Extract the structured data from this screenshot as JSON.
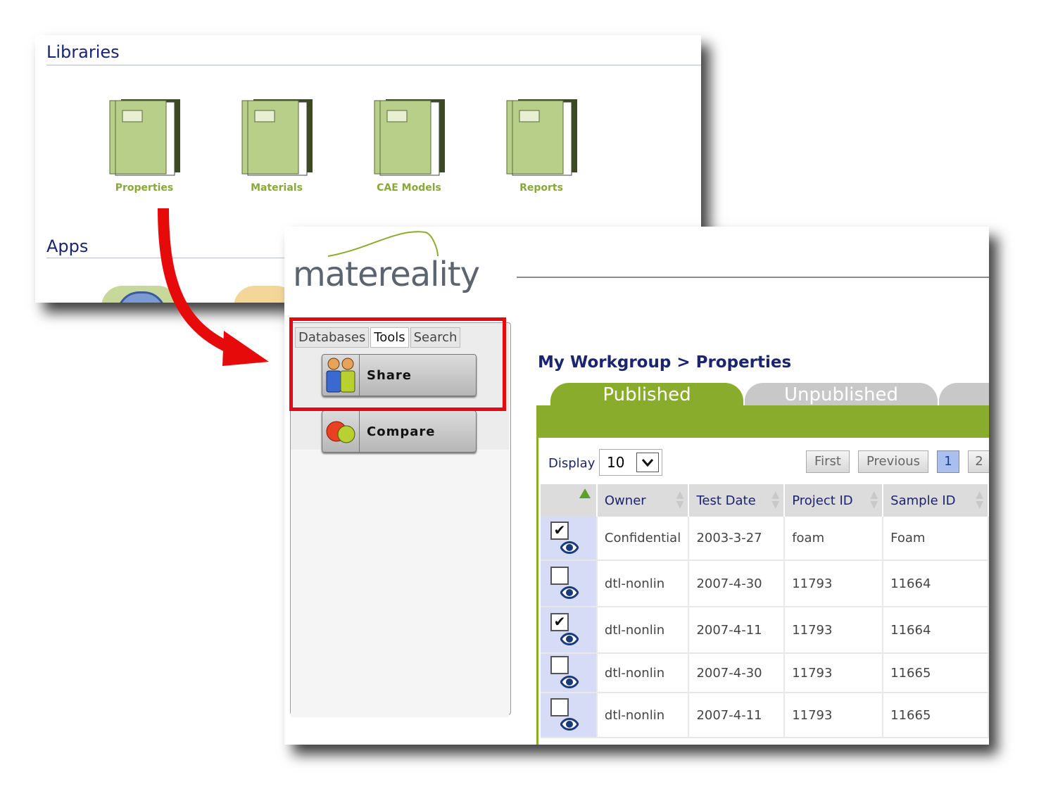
{
  "libraries": {
    "title": "Libraries",
    "items": [
      {
        "label": "Properties",
        "icon": "book-stack-icon"
      },
      {
        "label": "Materials",
        "icon": "book-stack-icon"
      },
      {
        "label": "CAE Models",
        "icon": "book-stack-icon"
      },
      {
        "label": "Reports",
        "icon": "book-stack-icon"
      }
    ]
  },
  "apps": {
    "title": "Apps"
  },
  "app": {
    "logo": "matereality",
    "side_tabs": [
      "Databases",
      "Tools",
      "Search"
    ],
    "tools": [
      {
        "label": "Share",
        "icon": "people-icon"
      },
      {
        "label": "Compare",
        "icon": "apple-orange-icon"
      }
    ],
    "breadcrumb": "My Workgroup > Properties",
    "tabs": {
      "published": "Published",
      "unpublished": "Unpublished"
    },
    "display_label": "Display",
    "display_value": "10",
    "pager": {
      "first": "First",
      "previous": "Previous",
      "page1": "1",
      "page2": "2"
    },
    "columns": [
      "Owner",
      "Test Date",
      "Project ID",
      "Sample ID"
    ],
    "rows": [
      {
        "checked": true,
        "owner": "Confidential",
        "test_date": "2003-3-27",
        "project_id": "foam",
        "sample_id": "Foam"
      },
      {
        "checked": false,
        "owner": "dtl-nonlin",
        "test_date": "2007-4-30",
        "project_id": "11793",
        "sample_id": "11664"
      },
      {
        "checked": true,
        "owner": "dtl-nonlin",
        "test_date": "2007-4-11",
        "project_id": "11793",
        "sample_id": "11664"
      },
      {
        "checked": false,
        "owner": "dtl-nonlin",
        "test_date": "2007-4-30",
        "project_id": "11793",
        "sample_id": "11665"
      },
      {
        "checked": false,
        "owner": "dtl-nonlin",
        "test_date": "2007-4-11",
        "project_id": "11793",
        "sample_id": "11665"
      }
    ]
  },
  "colors": {
    "accent_green": "#8aac2c",
    "title_blue": "#1a2470",
    "highlight_red": "#e60a0a"
  }
}
